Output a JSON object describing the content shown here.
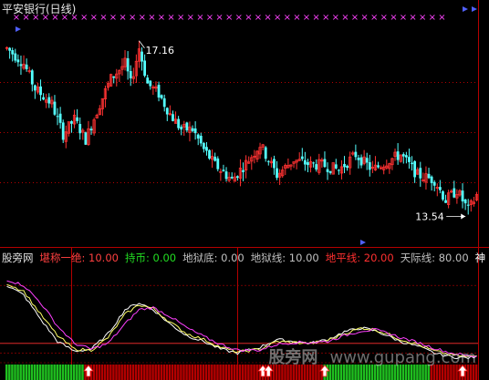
{
  "header": {
    "title": "平安银行(日线)",
    "high_label": "17.16",
    "low_label": "13.54"
  },
  "indicator": {
    "name": "股旁网",
    "items": [
      {
        "label": "堪称一绝:",
        "value": "10.00",
        "color": "#ff4040"
      },
      {
        "label": "持币:",
        "value": "0.00",
        "color": "#22dd22"
      },
      {
        "label": "地狱底:",
        "value": "0.00",
        "color": "#c0c0c0"
      },
      {
        "label": "地狱线:",
        "value": "10.00",
        "color": "#c0c0c0"
      },
      {
        "label": "地平线:",
        "value": "20.00",
        "color": "#ff3030"
      },
      {
        "label": "天际线:",
        "value": "80.00",
        "color": "#c0c0c0"
      }
    ],
    "trailing_label": "神"
  },
  "watermark": {
    "cn": "股旁网",
    "en": "www.gupang.com"
  },
  "colors": {
    "up": "#ff3232",
    "down": "#54ffff",
    "frame": "#b40000",
    "marker": "#ff44ff",
    "line_white": "#ffffff",
    "line_yellow": "#ffff66",
    "line_magenta": "#ff40ff"
  },
  "chart_data": [
    {
      "type": "candlestick",
      "title": "平安银行(日线)",
      "ylim": [
        13.0,
        17.6
      ],
      "annotations": [
        {
          "text": "17.16",
          "meaning": "period high"
        },
        {
          "text": "13.54",
          "meaning": "period low"
        }
      ],
      "anchors": [
        [
          0,
          16.9
        ],
        [
          6,
          16.6
        ],
        [
          10,
          16.1
        ],
        [
          16,
          15.8
        ],
        [
          20,
          15.2
        ],
        [
          24,
          15.5
        ],
        [
          28,
          15.1
        ],
        [
          33,
          15.8
        ],
        [
          37,
          16.3
        ],
        [
          42,
          16.6
        ],
        [
          44,
          16.2
        ],
        [
          47,
          16.9
        ],
        [
          50,
          16.2
        ],
        [
          54,
          16.0
        ],
        [
          58,
          15.6
        ],
        [
          62,
          15.3
        ],
        [
          66,
          15.3
        ],
        [
          70,
          14.9
        ],
        [
          74,
          14.6
        ],
        [
          80,
          14.3
        ],
        [
          86,
          14.7
        ],
        [
          90,
          15.0
        ],
        [
          96,
          14.4
        ],
        [
          102,
          14.7
        ],
        [
          108,
          14.6
        ],
        [
          112,
          14.6
        ],
        [
          118,
          14.5
        ],
        [
          124,
          14.8
        ],
        [
          130,
          14.5
        ],
        [
          136,
          14.7
        ],
        [
          140,
          14.8
        ],
        [
          146,
          14.4
        ],
        [
          152,
          14.3
        ],
        [
          156,
          13.9
        ],
        [
          160,
          14.1
        ],
        [
          164,
          13.7
        ],
        [
          167,
          14.0
        ]
      ],
      "count": 168
    },
    {
      "type": "line",
      "title": "股旁网",
      "ylim": [
        0,
        100
      ],
      "reference_levels": [
        0,
        10,
        20,
        80
      ],
      "series": [
        {
          "name": "white",
          "color": "#ffffff",
          "points": [
            [
              0,
              80
            ],
            [
              6,
              70
            ],
            [
              12,
              45
            ],
            [
              18,
              22
            ],
            [
              24,
              12
            ],
            [
              30,
              14
            ],
            [
              36,
              30
            ],
            [
              42,
              55
            ],
            [
              47,
              62
            ],
            [
              52,
              55
            ],
            [
              58,
              40
            ],
            [
              64,
              28
            ],
            [
              70,
              22
            ],
            [
              76,
              14
            ],
            [
              82,
              10
            ],
            [
              90,
              16
            ],
            [
              96,
              24
            ],
            [
              102,
              22
            ],
            [
              108,
              20
            ],
            [
              114,
              24
            ],
            [
              120,
              32
            ],
            [
              126,
              36
            ],
            [
              131,
              33
            ],
            [
              136,
              27
            ],
            [
              140,
              22
            ],
            [
              146,
              17
            ],
            [
              152,
              10
            ],
            [
              158,
              6
            ],
            [
              164,
              5
            ],
            [
              167,
              6
            ]
          ]
        },
        {
          "name": "yellow",
          "color": "#ffff66",
          "points": [
            [
              0,
              82
            ],
            [
              6,
              74
            ],
            [
              12,
              50
            ],
            [
              18,
              28
            ],
            [
              24,
              14
            ],
            [
              30,
              13
            ],
            [
              36,
              26
            ],
            [
              42,
              50
            ],
            [
              47,
              60
            ],
            [
              52,
              56
            ],
            [
              58,
              42
            ],
            [
              64,
              30
            ],
            [
              70,
              24
            ],
            [
              76,
              16
            ],
            [
              82,
              11
            ],
            [
              90,
              14
            ],
            [
              96,
              22
            ],
            [
              102,
              21
            ],
            [
              108,
              20
            ],
            [
              114,
              23
            ],
            [
              120,
              30
            ],
            [
              126,
              36
            ],
            [
              131,
              34
            ],
            [
              136,
              29
            ],
            [
              140,
              24
            ],
            [
              146,
              19
            ],
            [
              152,
              12
            ],
            [
              158,
              8
            ],
            [
              164,
              6
            ],
            [
              167,
              7
            ]
          ]
        },
        {
          "name": "magenta",
          "color": "#ff40ff",
          "points": [
            [
              0,
              86
            ],
            [
              6,
              80
            ],
            [
              12,
              62
            ],
            [
              18,
              38
            ],
            [
              24,
              20
            ],
            [
              30,
              14
            ],
            [
              36,
              20
            ],
            [
              42,
              40
            ],
            [
              47,
              55
            ],
            [
              52,
              57
            ],
            [
              58,
              48
            ],
            [
              64,
              36
            ],
            [
              70,
              27
            ],
            [
              76,
              19
            ],
            [
              82,
              13
            ],
            [
              90,
              13
            ],
            [
              96,
              19
            ],
            [
              102,
              21
            ],
            [
              108,
              21
            ],
            [
              114,
              22
            ],
            [
              120,
              28
            ],
            [
              126,
              33
            ],
            [
              131,
              34
            ],
            [
              136,
              30
            ],
            [
              140,
              26
            ],
            [
              146,
              21
            ],
            [
              152,
              15
            ],
            [
              158,
              10
            ],
            [
              164,
              7
            ],
            [
              167,
              7
            ]
          ]
        }
      ],
      "signal_arrows_at": [
        29,
        91,
        93,
        113,
        162
      ]
    }
  ]
}
